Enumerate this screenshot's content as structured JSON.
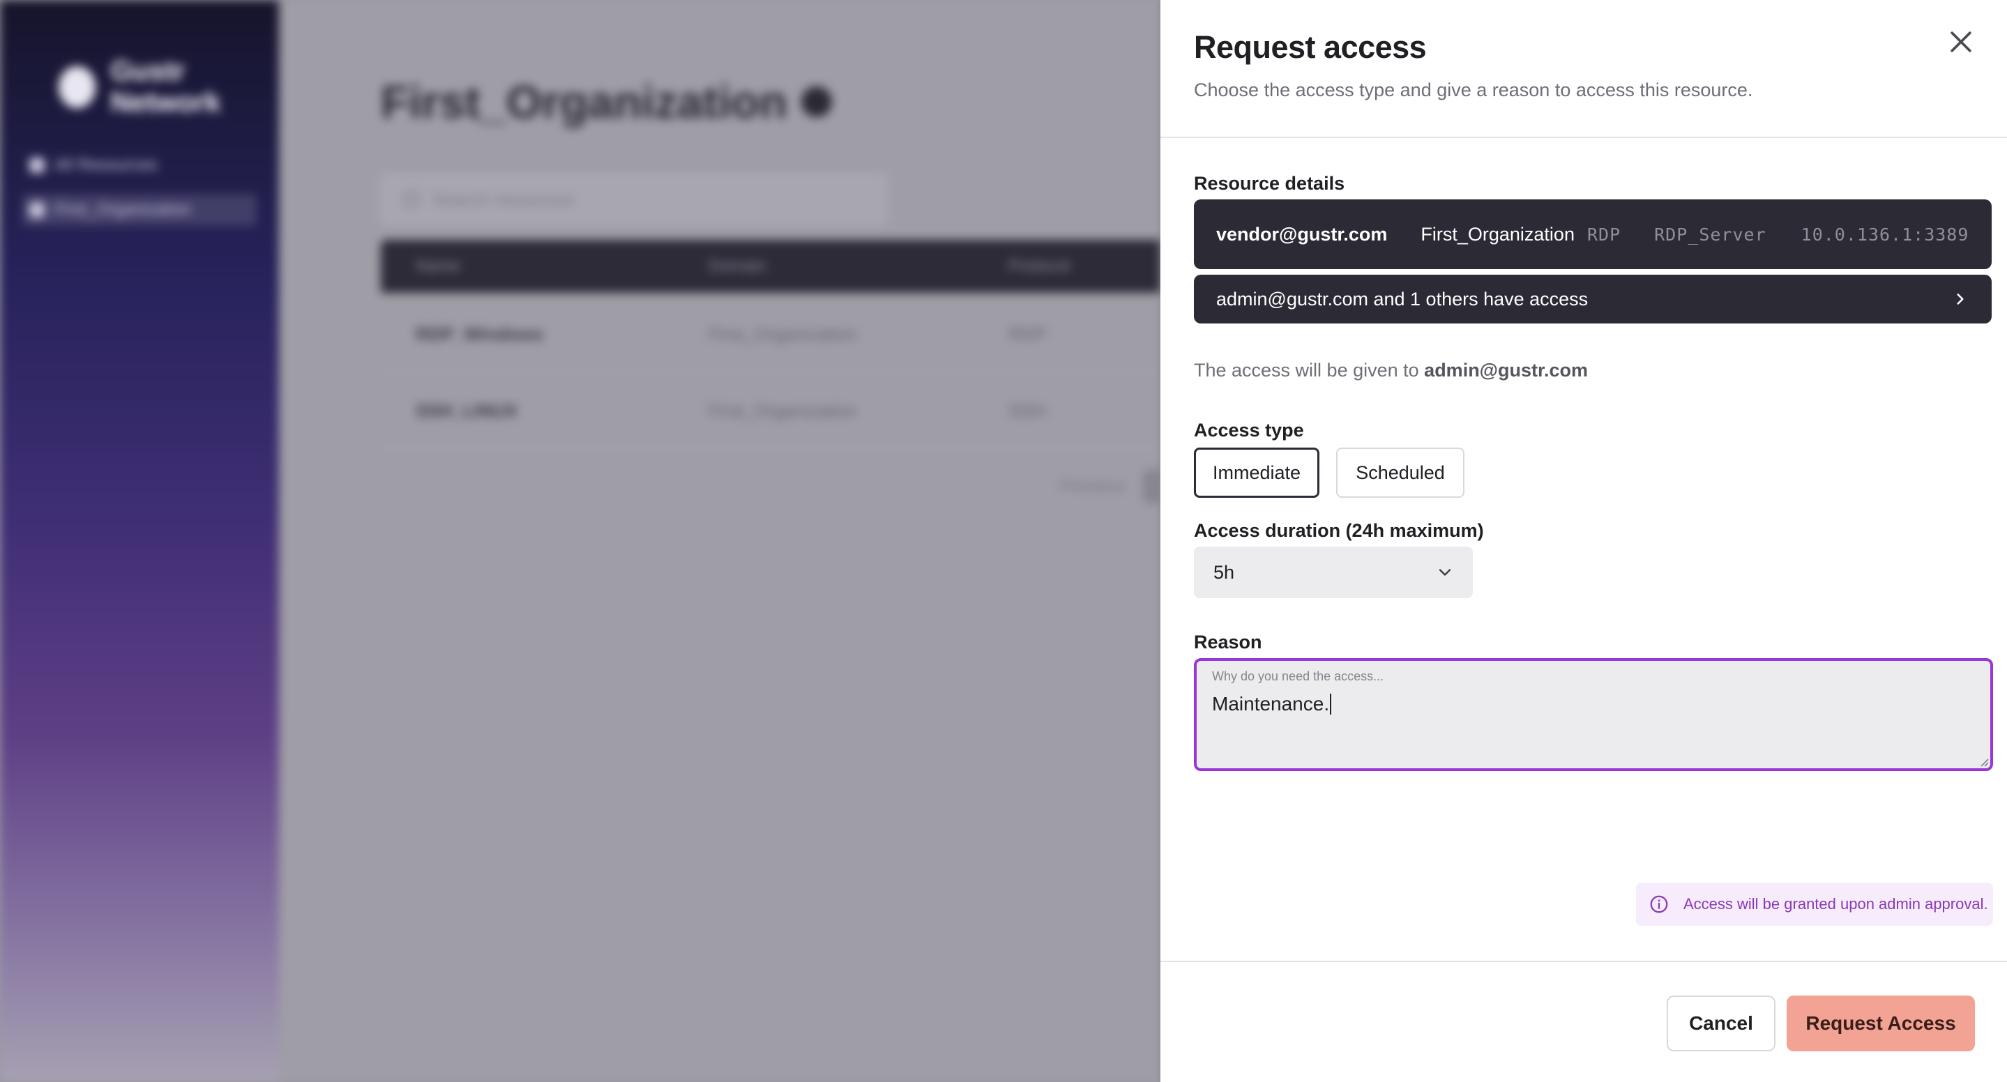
{
  "background": {
    "app_name": "Gustr Network",
    "nav_items": [
      "All Resources",
      "First_Organization"
    ],
    "page_title": "First_Organization",
    "search_placeholder": "Search resources",
    "columns": [
      "Name",
      "Domain",
      "Protocol"
    ],
    "rows": [
      {
        "name": "RDP_Windows",
        "domain": "First_Organization",
        "protocol": "RDP"
      },
      {
        "name": "SSH_LINUX",
        "domain": "First_Organization",
        "protocol": "SSH"
      }
    ],
    "pager_prev": "Previous"
  },
  "drawer": {
    "title": "Request access",
    "subtitle": "Choose the access type and give a reason to access this resource.",
    "close_icon": "close-icon",
    "resource_details_label": "Resource details",
    "resource": {
      "user": "vendor@gustr.com",
      "organization": "First_Organization",
      "protocol": "RDP",
      "server": "RDP_Server",
      "address": "10.0.136.1:3389"
    },
    "access_list_text": "admin@gustr.com and 1 others have access",
    "given_to_prefix": "The access will be given to",
    "given_to_user": "admin@gustr.com",
    "access_type_label": "Access type",
    "access_types": [
      "Immediate",
      "Scheduled"
    ],
    "selected_access_type": "Immediate",
    "duration_label": "Access duration (24h maximum)",
    "duration_value": "5h",
    "reason_label": "Reason",
    "reason_placeholder": "Why do you need the access...",
    "reason_value": "Maintenance.",
    "info_text": "Access will be granted upon admin approval.",
    "cancel_label": "Cancel",
    "submit_label": "Request Access"
  },
  "colors": {
    "overlay": "#9a98a1",
    "dark_panel": "#2b2a35",
    "focus_border": "#9a35d6",
    "primary_button": "#f2a393",
    "info_bg": "#f6ecfb",
    "info_text": "#8a38b6"
  }
}
